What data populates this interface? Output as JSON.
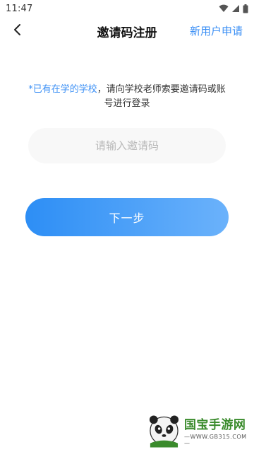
{
  "status_bar": {
    "time": "11:47"
  },
  "header": {
    "title": "邀请码注册",
    "right_action": "新用户申请"
  },
  "hint": {
    "highlight": "*已有在学的学校",
    "text": "，请向学校老师索要邀请码或账号进行登录"
  },
  "invite_input": {
    "placeholder": "请输入邀请码",
    "value": ""
  },
  "next_button": {
    "label": "下一步"
  },
  "watermark": {
    "brand": "国宝手游网",
    "url": "—WWW.GB315.COM—"
  },
  "colors": {
    "accent": "#3b8ff5",
    "button_start": "#2d8ef5",
    "button_end": "#6bb2fb",
    "input_bg": "#f8f8f8"
  }
}
